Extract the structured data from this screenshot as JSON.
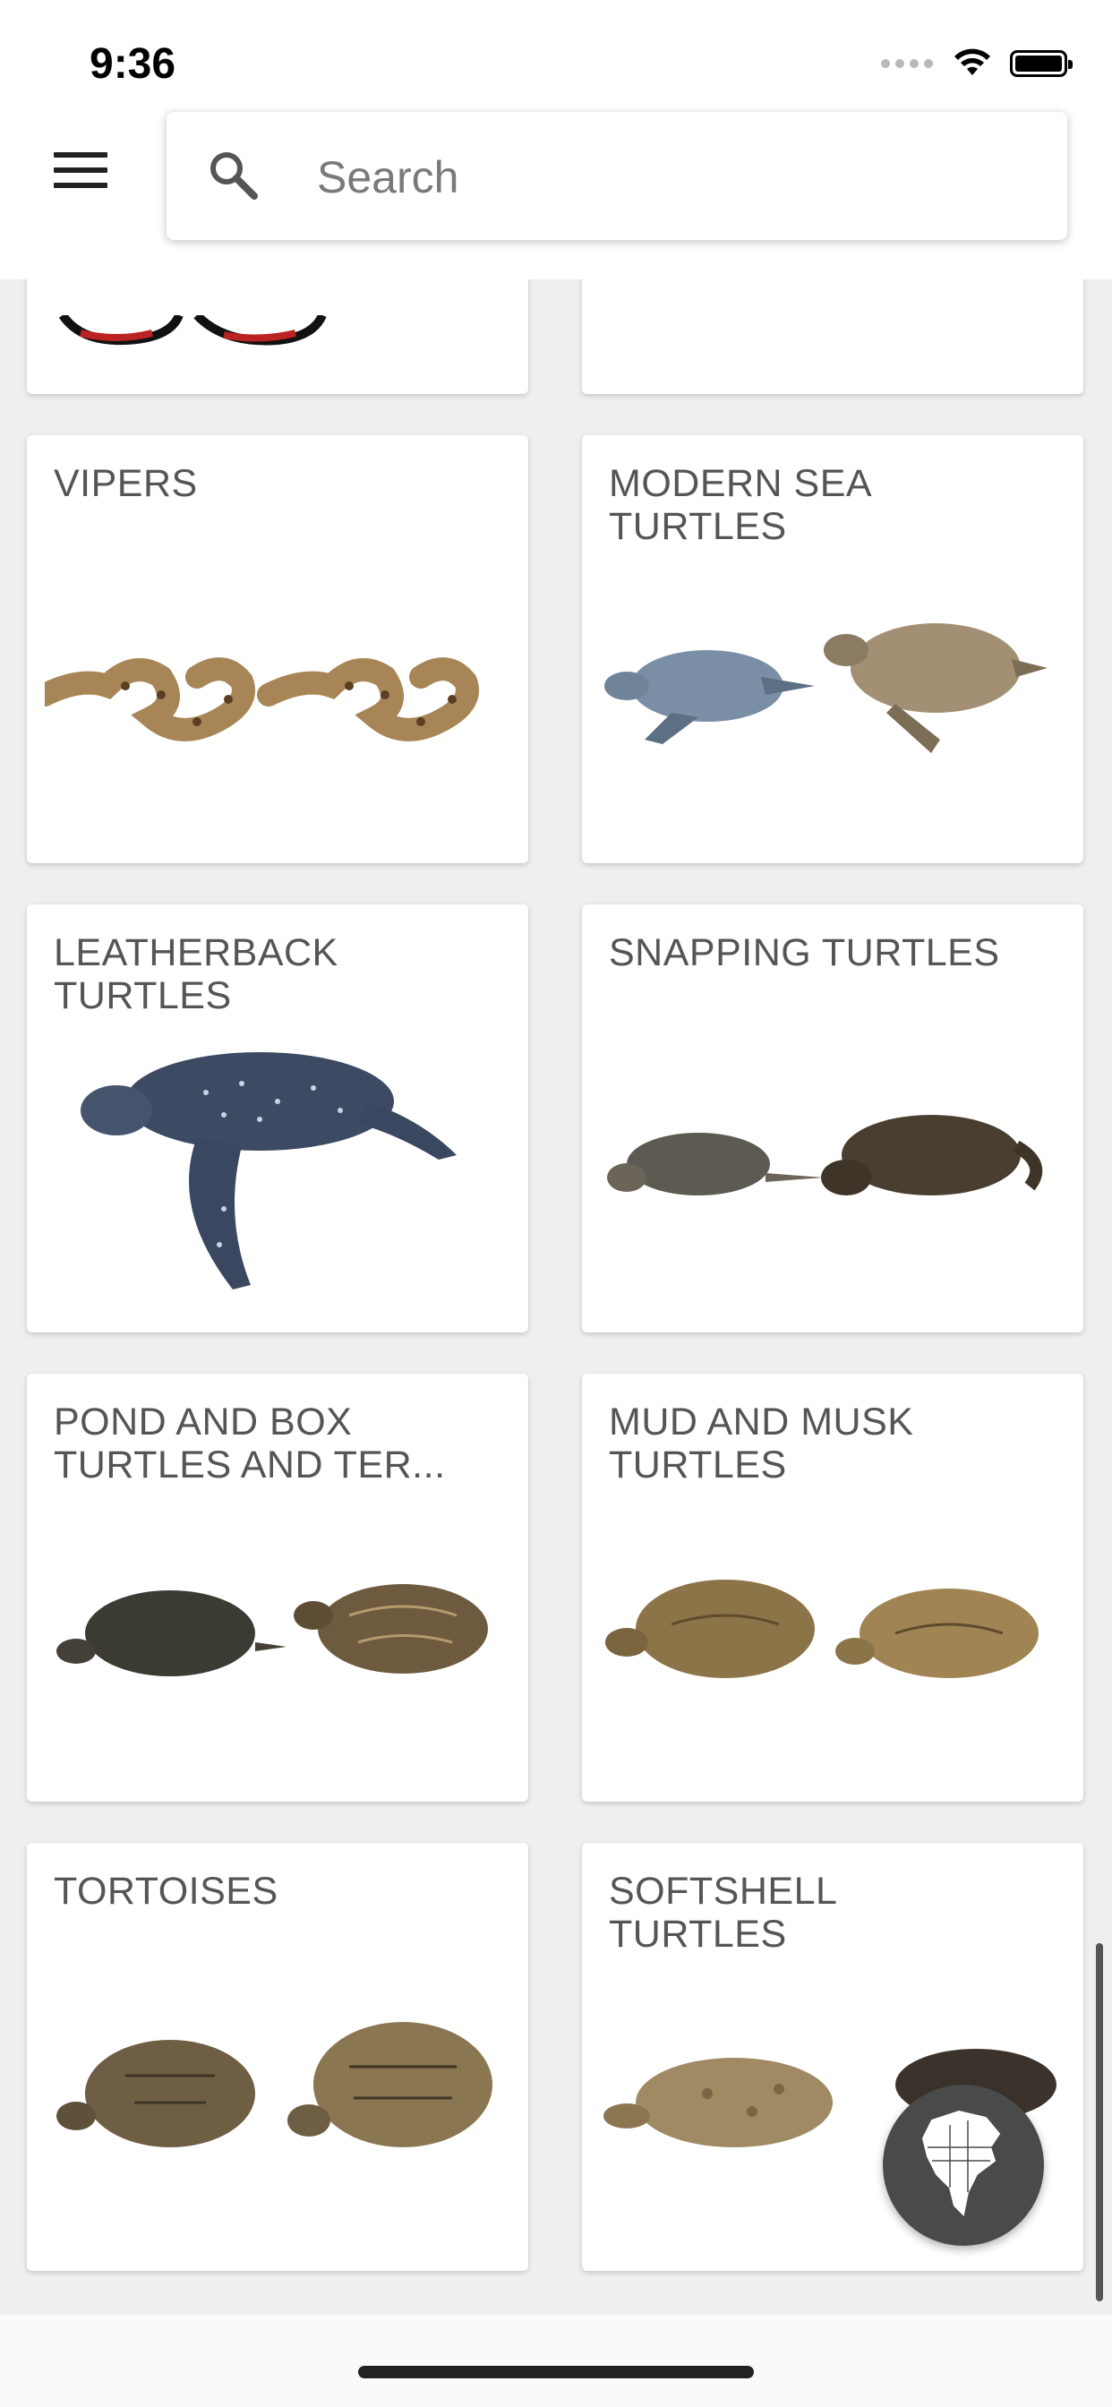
{
  "status_bar": {
    "time": "9:36"
  },
  "header": {
    "search_placeholder": "Search"
  },
  "cards": [
    {
      "title": "VIPERS"
    },
    {
      "title": "MODERN SEA\nTURTLES"
    },
    {
      "title": "LEATHERBACK\nTURTLES"
    },
    {
      "title": "SNAPPING TURTLES"
    },
    {
      "title": "POND AND BOX\nTURTLES AND TER..."
    },
    {
      "title": "MUD AND MUSK\nTURTLES"
    },
    {
      "title": "TORTOISES"
    },
    {
      "title": "SOFTSHELL\nTURTLES"
    }
  ],
  "fab": {
    "icon": "north-america-map-icon"
  }
}
